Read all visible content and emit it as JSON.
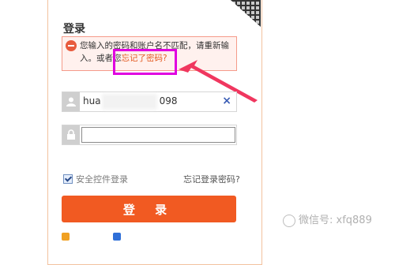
{
  "login": {
    "title": "登录",
    "error_line1": "您输入的密码和账户名不匹配，请重新输",
    "error_line2_prefix": "入。或者您",
    "error_link": "忘记了密码?",
    "username_value": "hua",
    "username_tail": "098",
    "clear_icon": "×",
    "secure_control_label": "安全控件登录",
    "forgot_login_password": "忘记登录密码?",
    "login_button": "登 录",
    "bottom_alipay": "",
    "bottom_taobao": "",
    "bottom_register": ""
  },
  "watermark": {
    "wechat": "微信号: xfq889",
    "baidu": ""
  },
  "colors": {
    "accent": "#f15a22",
    "error_border": "#f59b8a",
    "highlight": "#e000e0",
    "arrow": "#f0375f"
  }
}
